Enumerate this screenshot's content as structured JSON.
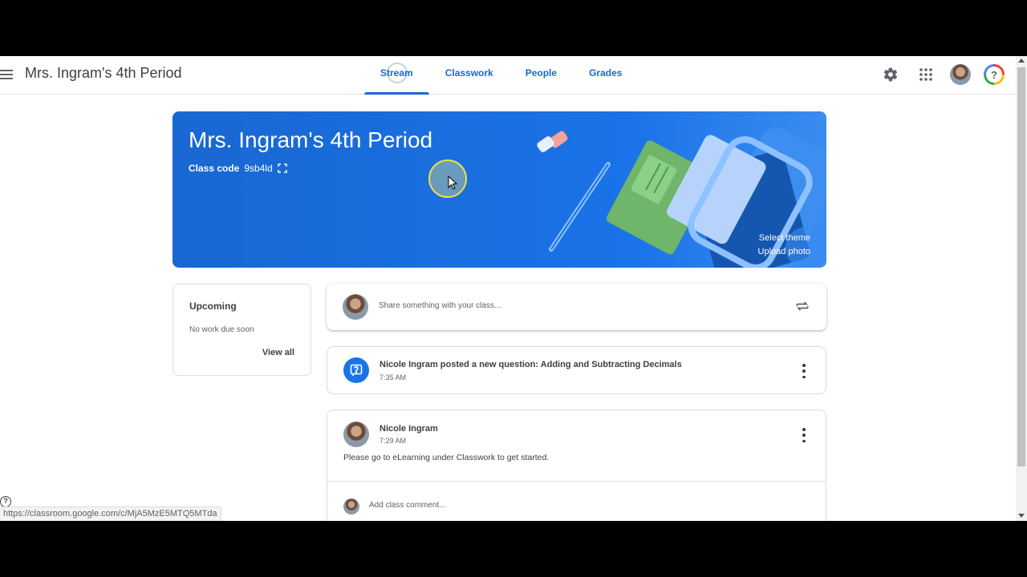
{
  "header": {
    "title": "Mrs. Ingram's 4th Period",
    "tabs": [
      {
        "label": "Stream",
        "active": true
      },
      {
        "label": "Classwork",
        "active": false
      },
      {
        "label": "People",
        "active": false
      },
      {
        "label": "Grades",
        "active": false
      }
    ],
    "icons": [
      "menu-icon",
      "gear-icon",
      "apps-icon",
      "avatar",
      "help-icon"
    ]
  },
  "banner": {
    "title": "Mrs. Ingram's 4th Period",
    "class_code_label": "Class code",
    "class_code": "9sb4ld",
    "select_theme": "Select theme",
    "upload_photo": "Upload photo",
    "color": "#1a73e8"
  },
  "upcoming": {
    "title": "Upcoming",
    "empty_text": "No work due soon",
    "view_all": "View all"
  },
  "share": {
    "placeholder": "Share something with your class..."
  },
  "stream": {
    "items": [
      {
        "title": "Nicole Ingram posted a new question: Adding and Subtracting Decimals",
        "time": "7:35 AM"
      },
      {
        "author": "Nicole Ingram",
        "time": "7:29 AM",
        "body": "Please go to eLearning under Classwork to get started.",
        "comment_placeholder": "Add class comment..."
      }
    ]
  },
  "status_bar": {
    "url": "https://classroom.google.com/c/MjA5MzE5MTQ5MTda"
  },
  "colors": {
    "accent": "#1967d2",
    "banner": "#1a73e8"
  }
}
